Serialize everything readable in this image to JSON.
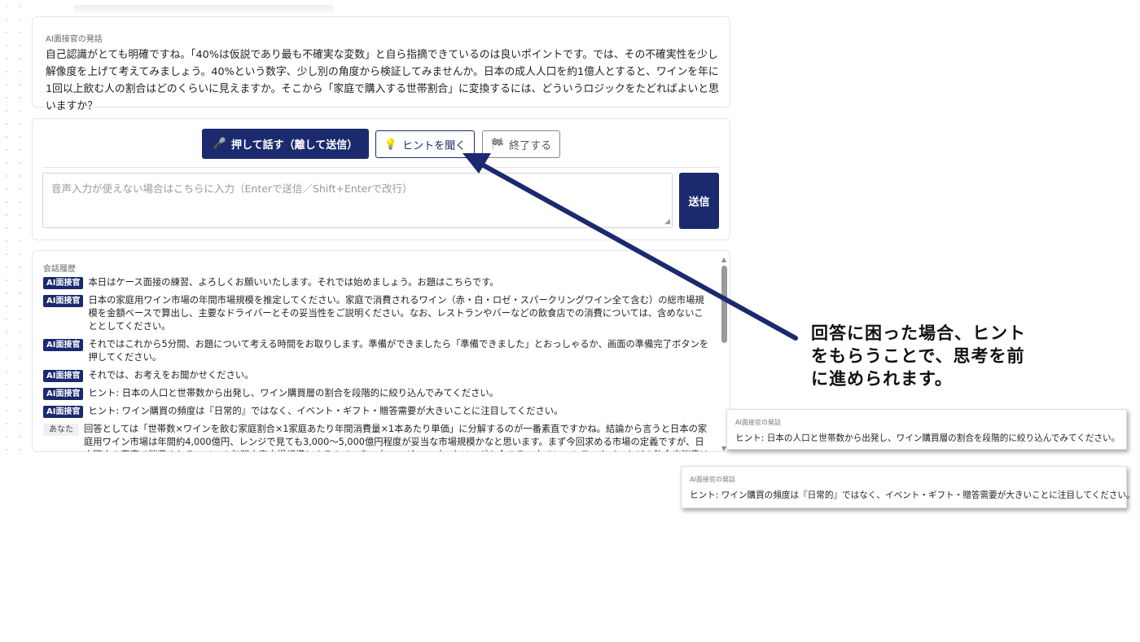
{
  "speech_card": {
    "label": "AI面接官の発話",
    "text": "自己認識がとても明確ですね。「40%は仮説であり最も不確実な変数」と自ら指摘できているのは良いポイントです。では、その不確実性を少し解像度を上げて考えてみましょう。40%という数字、少し別の角度から検証してみませんか。日本の成人人口を約1億人とすると、ワインを年に1回以上飲む人の割合はどのくらいに見えますか。そこから「家庭で購入する世帯割合」に変換するには、どういうロジックをたどればよいと思いますか？"
  },
  "controls": {
    "talk_icon": "🎤",
    "talk_label": "押して話す（離して送信）",
    "hint_icon": "💡",
    "hint_label": "ヒントを聞く",
    "end_icon": "🏁",
    "end_label": "終了する",
    "input_placeholder": "音声入力が使えない場合はこちらに入力（Enterで送信／Shift+Enterで改行）",
    "send_label": "送信"
  },
  "history": {
    "title": "会話履歴",
    "items": [
      {
        "speaker": "AI面接官",
        "text": "本日はケース面接の練習、よろしくお願いいたします。それでは始めましょう。お題はこちらです。"
      },
      {
        "speaker": "AI面接官",
        "text": "日本の家庭用ワイン市場の年間市場規模を推定してください。家庭で消費されるワイン（赤・白・ロゼ・スパークリングワイン全て含む）の総市場規模を金額ベースで算出し、主要なドライバーとその妥当性をご説明ください。なお、レストランやバーなどの飲食店での消費については、含めないこととしてください。"
      },
      {
        "speaker": "AI面接官",
        "text": "それではこれから5分間、お題について考える時間をお取りします。準備ができましたら「準備できました」とおっしゃるか、画面の準備完了ボタンを押してください。"
      },
      {
        "speaker": "AI面接官",
        "text": "それでは、お考えをお聞かせください。"
      },
      {
        "speaker": "AI面接官",
        "text": "ヒント: 日本の人口と世帯数から出発し、ワイン購買層の割合を段階的に絞り込んでみてください。"
      },
      {
        "speaker": "AI面接官",
        "text": "ヒント: ワイン購買の頻度は『日常的』ではなく、イベント・ギフト・贈答需要が大きいことに注目してください。"
      },
      {
        "speaker": "あなた",
        "text": "回答としては「世帯数×ワインを飲む家庭割合×1家庭あたり年間消費量×1本あたり単価」に分解するのが一番素直ですかね。結論から言うと日本の家庭用ワイン市場は年間約4,000億円、レンジで見ても3,000〜5,000億円程度が妥当な市場規模かなと思います。まず今回求める市場の定義ですが、日本国内の家庭で消費されるワインの年間小売市場規模とするので、赤・白・ロゼ・スパークリングを含める一方でレストランやバーなどの飲食店消費は除外します。 市場規模の構造化としては、"
      }
    ]
  },
  "annotation": {
    "lines": [
      "回答に困った場合、ヒント",
      "をもらうことで、思考を前",
      "に進められます。"
    ]
  },
  "callouts": [
    {
      "label": "AI面接官の発話",
      "text": "ヒント: 日本の人口と世帯数から出発し、ワイン購買層の割合を段階的に絞り込んでみてください。"
    },
    {
      "label": "AI面接官の発話",
      "text": "ヒント: ワイン購買の頻度は『日常的』ではなく、イベント・ギフト・贈答需要が大きいことに注目してください。"
    }
  ],
  "colors": {
    "primary": "#1b2a6e",
    "arrow": "#1b2a6e"
  }
}
